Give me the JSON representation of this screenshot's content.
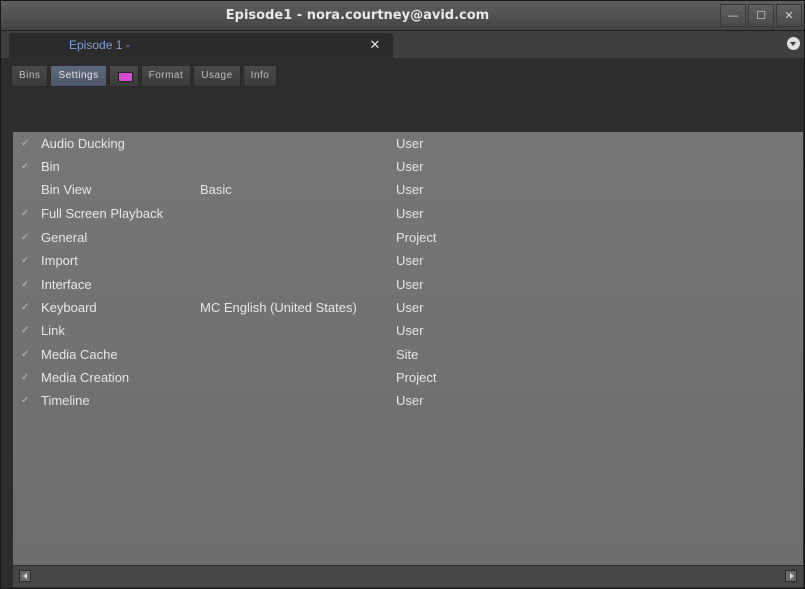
{
  "window": {
    "title": "Episode1 - nora.courtney@avid.com",
    "controls": {
      "minimize": "—",
      "maximize": "☐",
      "close": "✕"
    }
  },
  "tab": {
    "label": "Episode 1 -",
    "close": "✕"
  },
  "subtabs": [
    {
      "label": "Bins",
      "active": false
    },
    {
      "label": "Settings",
      "active": true
    },
    {
      "label": "",
      "icon": "layout-icon",
      "active": false
    },
    {
      "label": "Format",
      "active": false
    },
    {
      "label": "Usage",
      "active": false
    },
    {
      "label": "Info",
      "active": false
    }
  ],
  "settings": [
    {
      "checked": "✓",
      "name": "Audio Ducking",
      "kind": "",
      "scope": "User"
    },
    {
      "checked": "✓",
      "name": "Bin",
      "kind": "",
      "scope": "User"
    },
    {
      "checked": "",
      "name": "Bin View",
      "kind": "Basic",
      "scope": "User"
    },
    {
      "checked": "✓",
      "name": "Full Screen Playback",
      "kind": "",
      "scope": "User"
    },
    {
      "checked": "✓",
      "name": "General",
      "kind": "",
      "scope": "Project"
    },
    {
      "checked": "✓",
      "name": "Import",
      "kind": "",
      "scope": "User"
    },
    {
      "checked": "✓",
      "name": "Interface",
      "kind": "",
      "scope": "User"
    },
    {
      "checked": "✓",
      "name": "Keyboard",
      "kind": "MC English (United States)",
      "scope": "User"
    },
    {
      "checked": "✓",
      "name": "Link",
      "kind": "",
      "scope": "User"
    },
    {
      "checked": "✓",
      "name": "Media Cache",
      "kind": "",
      "scope": "Site"
    },
    {
      "checked": "✓",
      "name": "Media Creation",
      "kind": "",
      "scope": "Project"
    },
    {
      "checked": "✓",
      "name": "Timeline",
      "kind": "",
      "scope": "User"
    }
  ],
  "colors": {
    "accent_tab_text": "#7f9fd8",
    "active_subtab": "#5e6a7c",
    "icon_tab_swatch": "#d64bd6",
    "content_bg": "#767676"
  }
}
